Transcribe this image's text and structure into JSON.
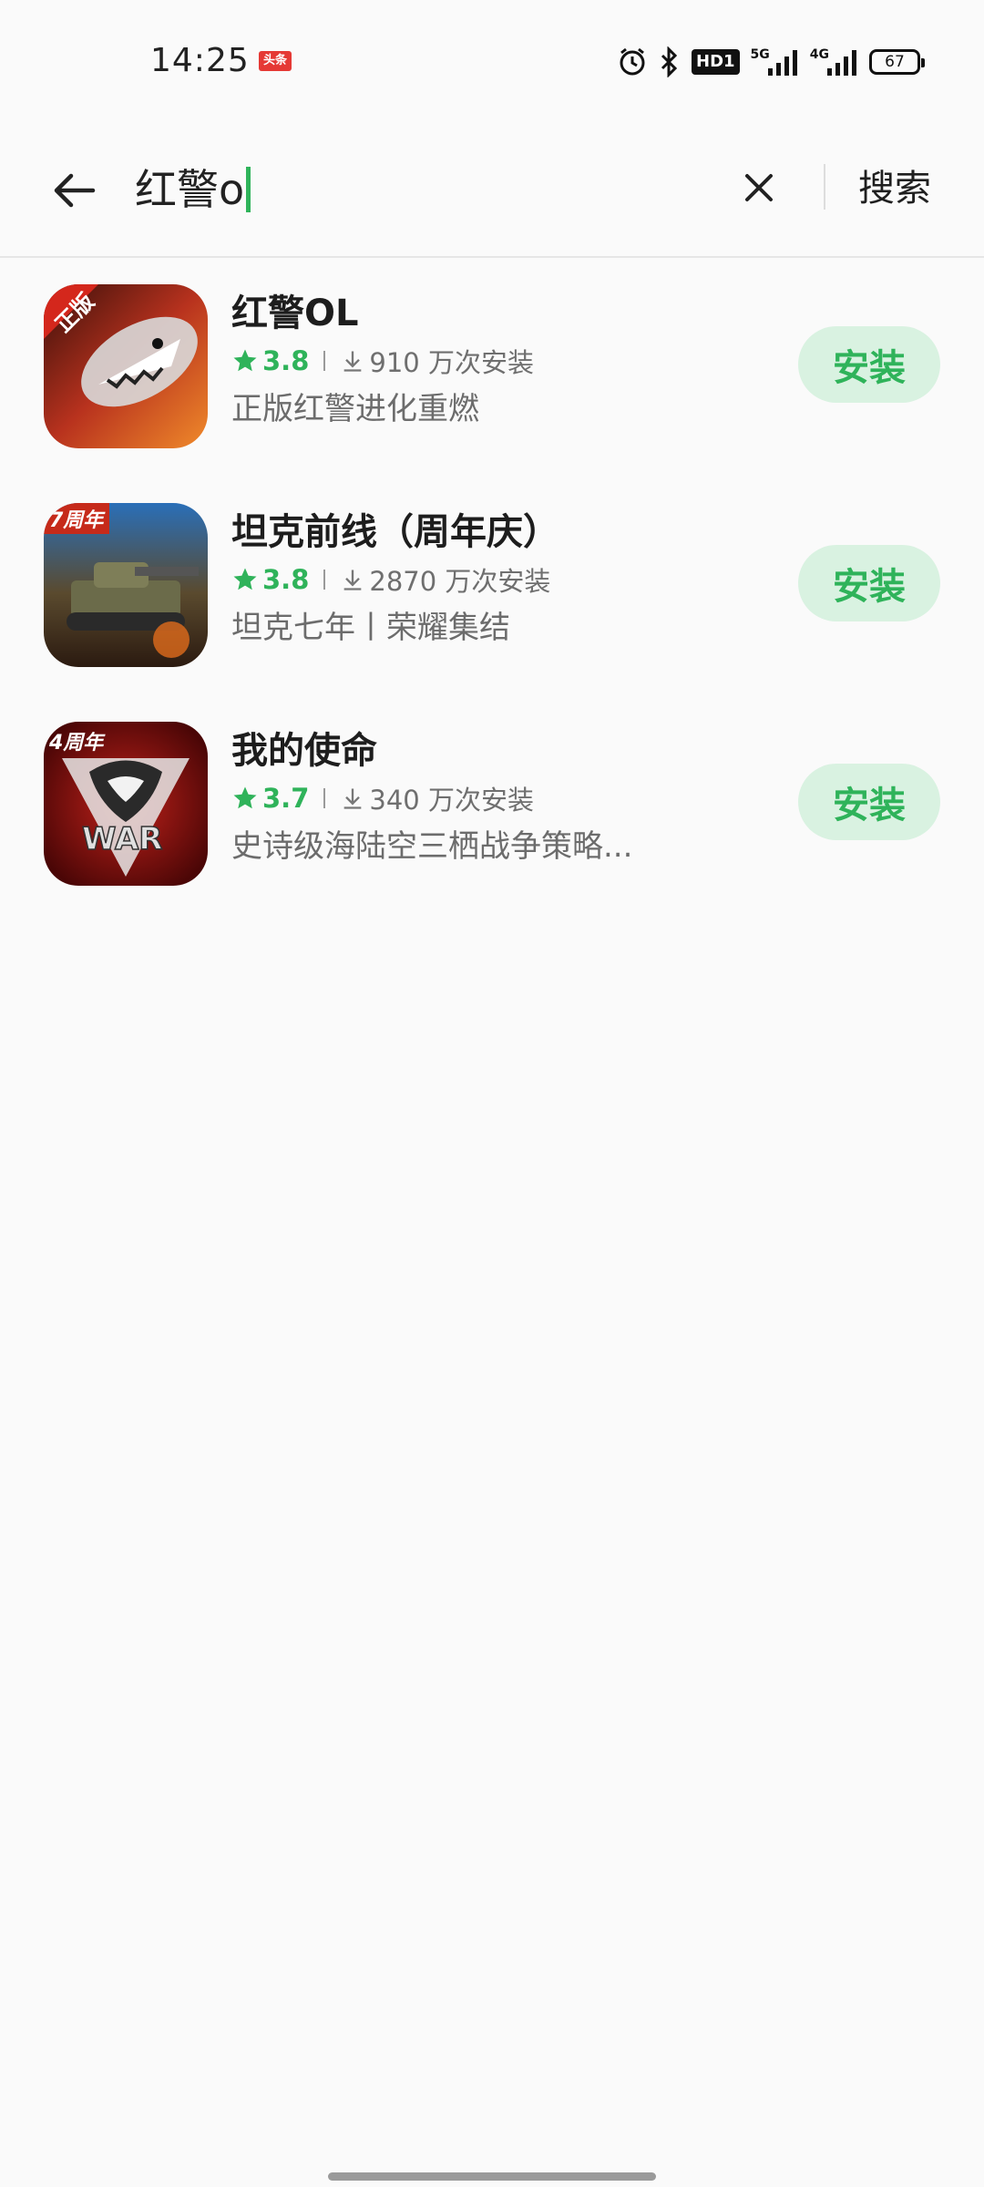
{
  "status_bar": {
    "time": "14:25",
    "news_badge": "头条",
    "hd_label": "HD1",
    "net1": "5G",
    "net2": "4G",
    "battery": "67"
  },
  "search": {
    "query": "红警o",
    "search_button": "搜索",
    "back_icon": "arrow-left-icon",
    "clear_icon": "close-icon"
  },
  "results": [
    {
      "name": "红警OL",
      "rating": "3.8",
      "installs": "910 万次安装",
      "description": "正版红警进化重燃",
      "install_label": "安装",
      "badge": "正版"
    },
    {
      "name": "坦克前线（周年庆）",
      "rating": "3.8",
      "installs": "2870 万次安装",
      "description": "坦克七年丨荣耀集结",
      "install_label": "安装",
      "badge": "7周年"
    },
    {
      "name": "我的使命",
      "rating": "3.7",
      "installs": "340 万次安装",
      "description": "史诗级海陆空三栖战争策略...",
      "install_label": "安装",
      "badge": "4周年",
      "icon_text": "WAR"
    }
  ],
  "colors": {
    "accent": "#2fb35a",
    "install_bg": "#d9f2e1",
    "background": "#fafafa"
  }
}
